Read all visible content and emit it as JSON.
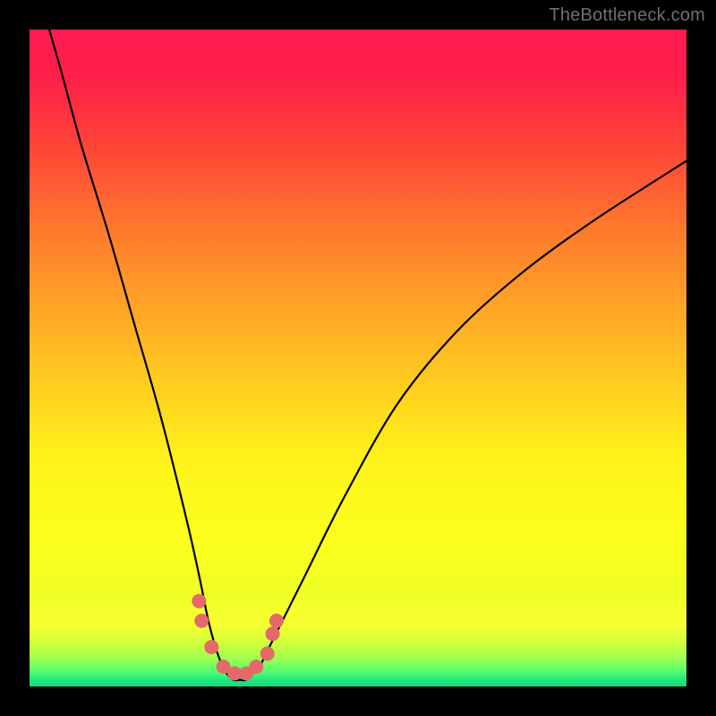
{
  "watermark": "TheBottleneck.com",
  "chart_data": {
    "type": "line",
    "title": "",
    "xlabel": "",
    "ylabel": "",
    "xlim": [
      0,
      100
    ],
    "ylim": [
      0,
      100
    ],
    "grid": false,
    "series": [
      {
        "name": "bottleneck-curve",
        "x": [
          3,
          5,
          8,
          12,
          16,
          20,
          24,
          26,
          27,
          28,
          29,
          30,
          31,
          32,
          33,
          34,
          35,
          36,
          38,
          42,
          48,
          56,
          65,
          75,
          86,
          100
        ],
        "y": [
          100,
          93,
          82,
          69,
          55,
          41,
          25,
          16,
          11,
          7,
          4,
          2,
          1,
          1,
          1,
          2,
          3,
          5,
          9,
          17,
          29,
          43,
          54,
          63,
          71,
          80
        ]
      }
    ],
    "markers": {
      "name": "highlight-dots",
      "points": [
        {
          "x": 25.8,
          "y": 13
        },
        {
          "x": 26.2,
          "y": 10
        },
        {
          "x": 27.7,
          "y": 6
        },
        {
          "x": 29.5,
          "y": 3
        },
        {
          "x": 31.2,
          "y": 2
        },
        {
          "x": 33.0,
          "y": 2
        },
        {
          "x": 34.5,
          "y": 3
        },
        {
          "x": 36.2,
          "y": 5
        },
        {
          "x": 37.0,
          "y": 8
        },
        {
          "x": 37.6,
          "y": 10
        }
      ]
    },
    "gradient_stops": [
      {
        "offset": 0.0,
        "color": "#ff1a50"
      },
      {
        "offset": 0.07,
        "color": "#ff1f4a"
      },
      {
        "offset": 0.18,
        "color": "#ff4538"
      },
      {
        "offset": 0.3,
        "color": "#ff782d"
      },
      {
        "offset": 0.42,
        "color": "#ffa326"
      },
      {
        "offset": 0.55,
        "color": "#ffd01e"
      },
      {
        "offset": 0.66,
        "color": "#fff41a"
      },
      {
        "offset": 0.77,
        "color": "#fbff1a"
      },
      {
        "offset": 0.86,
        "color": "#f0ff28"
      },
      {
        "offset": 0.905,
        "color": "#f8ff30"
      },
      {
        "offset": 0.93,
        "color": "#d6ff3a"
      },
      {
        "offset": 0.955,
        "color": "#a6ff4f"
      },
      {
        "offset": 0.975,
        "color": "#5dff6e"
      },
      {
        "offset": 0.99,
        "color": "#1eea7a"
      },
      {
        "offset": 1.0,
        "color": "#12d879"
      }
    ]
  }
}
